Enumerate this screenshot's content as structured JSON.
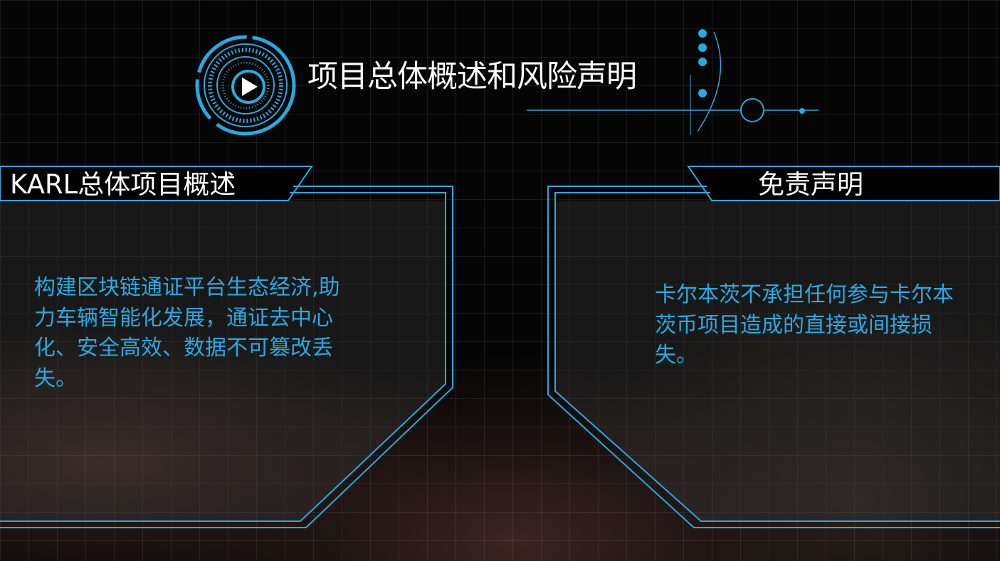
{
  "slide": {
    "title": "项目总体概述和风险声明",
    "accent_color": "#27aae1",
    "play_icon": "play-icon"
  },
  "left_panel": {
    "header": "KARL总体项目概述",
    "body": "构建区块链通证平台生态经济,助力车辆智能化发展，通证去中心化、安全高效、数据不可篡改丢失。"
  },
  "right_panel": {
    "header": "免责声明",
    "body": "卡尔本茨不承担任何参与卡尔本茨币项目造成的直接或间接损失。"
  }
}
